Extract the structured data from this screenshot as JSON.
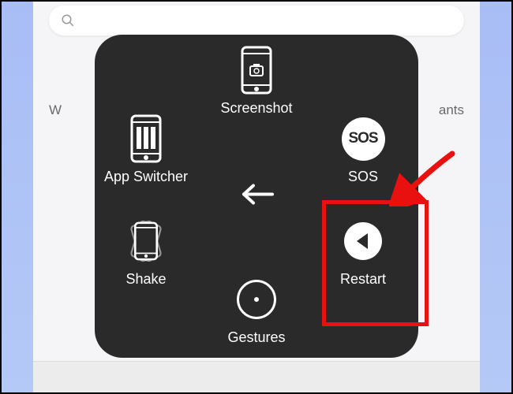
{
  "menu": {
    "screenshot": {
      "label": "Screenshot"
    },
    "appswitcher": {
      "label": "App Switcher"
    },
    "sos": {
      "label": "SOS",
      "badge": "SOS"
    },
    "shake": {
      "label": "Shake"
    },
    "restart": {
      "label": "Restart"
    },
    "gestures": {
      "label": "Gestures"
    }
  },
  "background": {
    "left_fragment": "W",
    "right_fragment": "ants"
  }
}
